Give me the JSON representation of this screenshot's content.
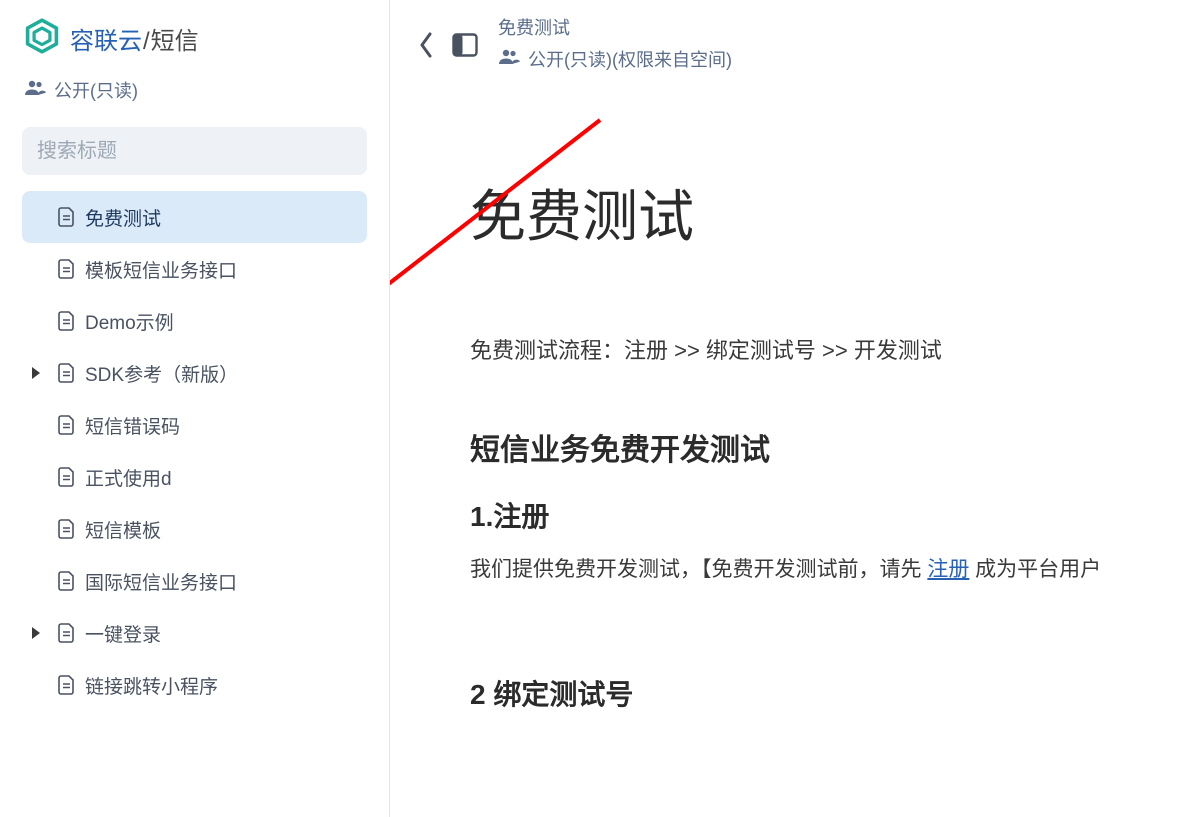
{
  "brand": {
    "primary": "容联云",
    "secondary": "短信"
  },
  "sidebar": {
    "permission_label": "公开(只读)",
    "search_placeholder": "搜索标题",
    "items": [
      {
        "label": "免费测试",
        "selected": true,
        "expandable": false
      },
      {
        "label": "模板短信业务接口",
        "selected": false,
        "expandable": false
      },
      {
        "label": "Demo示例",
        "selected": false,
        "expandable": false
      },
      {
        "label": "SDK参考（新版）",
        "selected": false,
        "expandable": true
      },
      {
        "label": "短信错误码",
        "selected": false,
        "expandable": false
      },
      {
        "label": "正式使用d",
        "selected": false,
        "expandable": false
      },
      {
        "label": "短信模板",
        "selected": false,
        "expandable": false
      },
      {
        "label": "国际短信业务接口",
        "selected": false,
        "expandable": false
      },
      {
        "label": "一键登录",
        "selected": false,
        "expandable": true
      },
      {
        "label": "链接跳转小程序",
        "selected": false,
        "expandable": false
      }
    ]
  },
  "header": {
    "breadcrumb_title": "免费测试",
    "permission_text": "公开(只读)(权限来自空间)"
  },
  "content": {
    "page_title": "免费测试",
    "flow_line": "免费测试流程：注册 >> 绑定测试号 >> 开发测试",
    "section1_h2": "短信业务免费开发测试",
    "section1_h3": "1.注册",
    "section1_para_before": "我们提供免费开发测试，【免费开发测试前，请先 ",
    "section1_link": "注册",
    "section1_para_after": " 成为平台用户",
    "section2_h3": "2 绑定测试号"
  },
  "annotation": {
    "arrow_color": "#ff0000"
  }
}
